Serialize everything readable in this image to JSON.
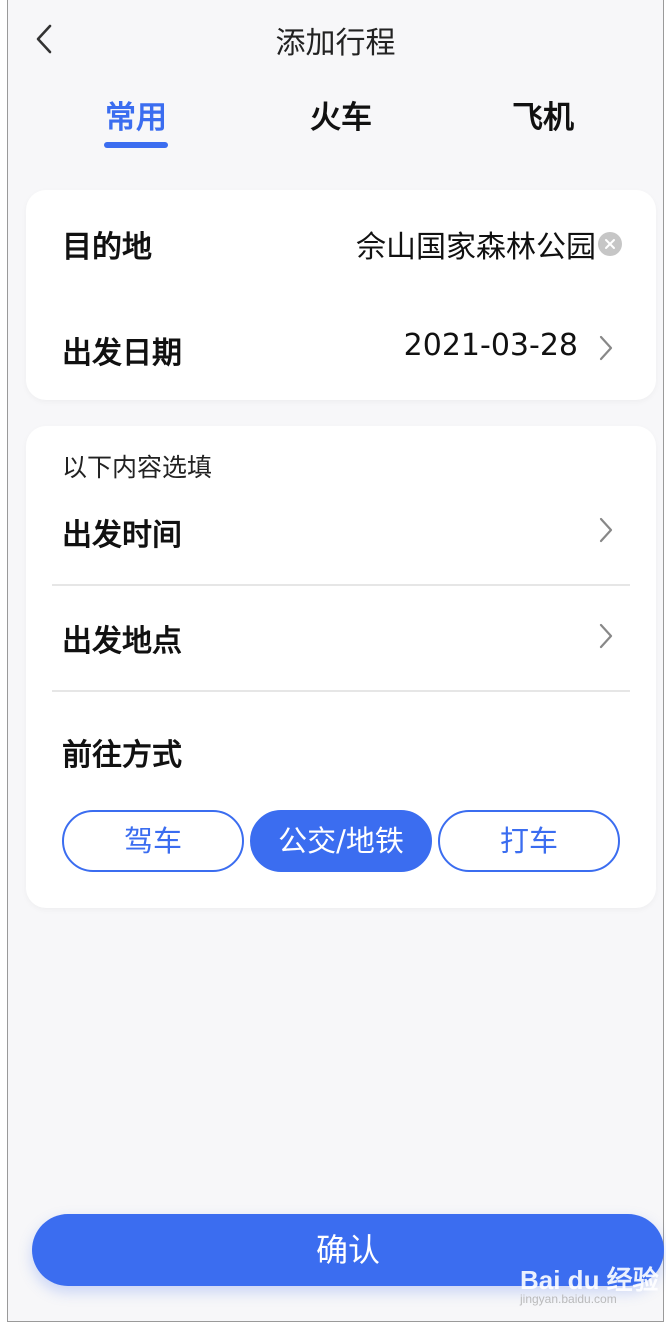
{
  "header": {
    "title": "添加行程"
  },
  "tabs": [
    {
      "label": "常用",
      "active": true
    },
    {
      "label": "火车",
      "active": false
    },
    {
      "label": "飞机",
      "active": false
    }
  ],
  "required_card": {
    "destination": {
      "label": "目的地",
      "value": "佘山国家森林公园"
    },
    "date": {
      "label": "出发日期",
      "value": "2021-03-28"
    }
  },
  "optional_card": {
    "hint": "以下内容选填",
    "time_label": "出发时间",
    "place_label": "出发地点",
    "mode_label": "前往方式",
    "modes": [
      {
        "label": "驾车",
        "selected": false
      },
      {
        "label": "公交/地铁",
        "selected": true
      },
      {
        "label": "打车",
        "selected": false
      }
    ]
  },
  "confirm_label": "确认",
  "watermark": {
    "text": "Bai du 经验",
    "sub": "jingyan.baidu.com"
  },
  "colors": {
    "accent": "#3b6df0",
    "background": "#f7f7f9",
    "card": "#ffffff",
    "divider": "#e6e6e6"
  },
  "icons": {
    "back": "chevron-left-icon",
    "clear": "clear-circle-icon",
    "more": "chevron-right-icon"
  }
}
